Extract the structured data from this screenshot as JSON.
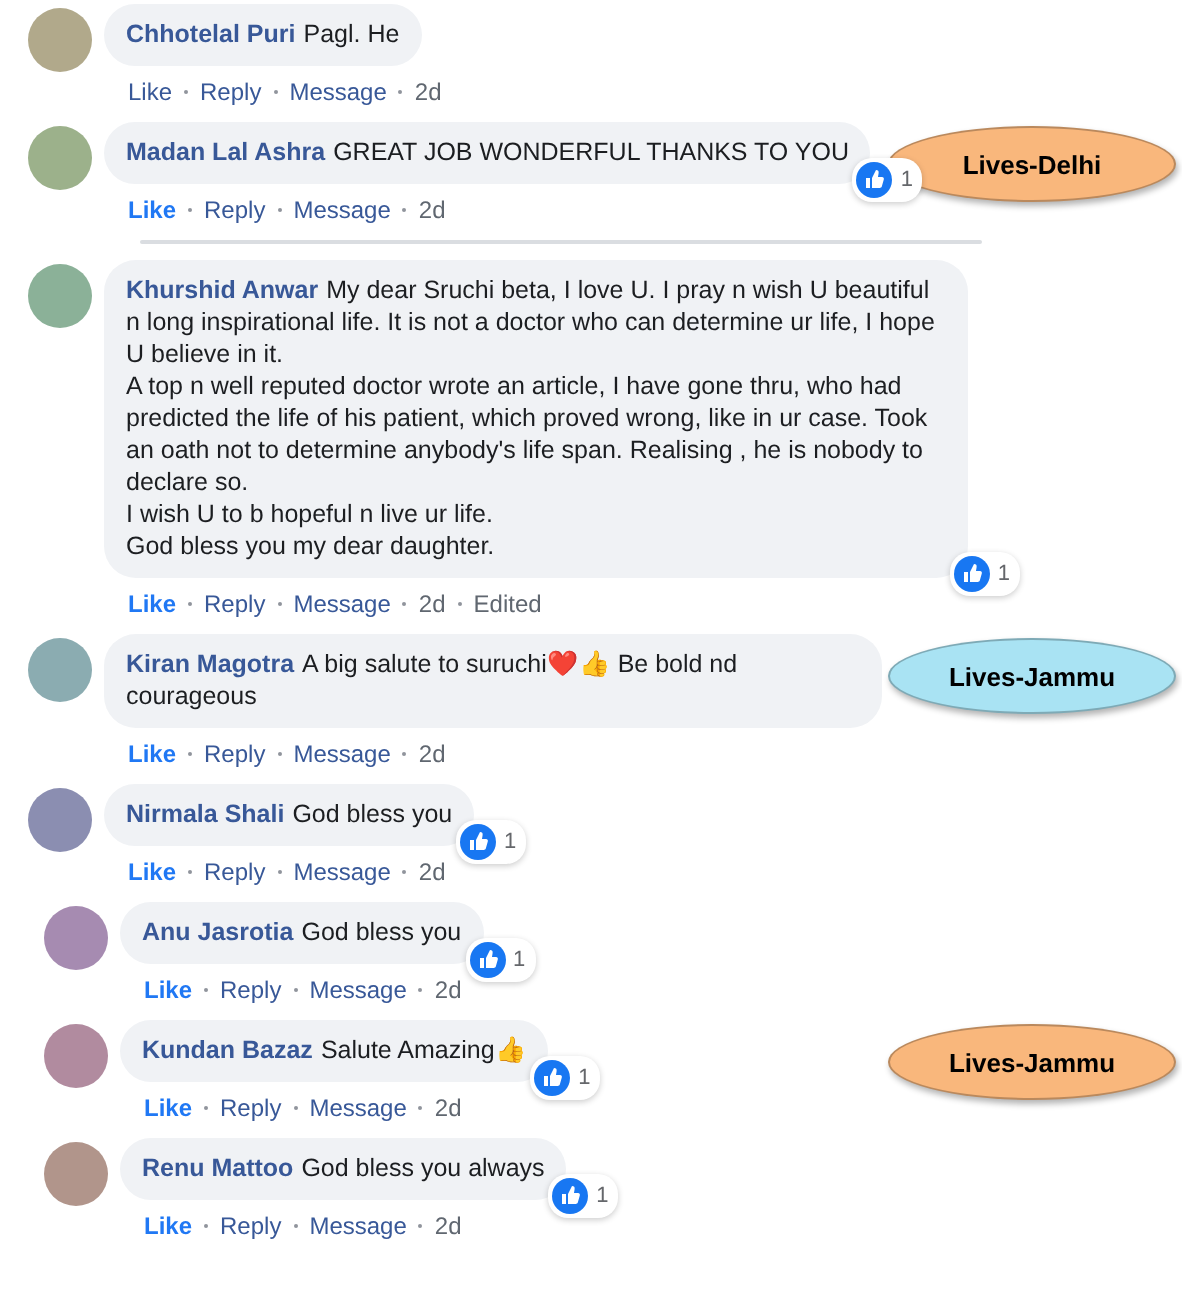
{
  "comments": [
    {
      "name": "Chhotelal Puri",
      "text": "Pagl. He",
      "liked": false,
      "actions": [
        "Like",
        "Reply",
        "Message",
        "2d"
      ]
    },
    {
      "name": "Madan Lal Ashra",
      "text": "GREAT JOB WONDERFUL THANKS TO YOU",
      "liked": true,
      "reactions": "1",
      "actions": [
        "Like",
        "Reply",
        "Message",
        "2d"
      ],
      "callout": {
        "label": "Lives-Delhi",
        "color": "#f9b77c"
      }
    },
    {
      "name": "Khurshid Anwar",
      "text": "My dear Sruchi beta, I love U. I pray n wish U beautiful n long inspirational life. It is not a doctor who can determine ur life, I hope U believe in it.\nA top n well reputed doctor wrote an article, I have gone thru, who had predicted the life of his patient, which proved wrong, like in ur case. Took an oath not to determine anybody's life span. Realising , he is nobody to declare so.\nI wish U to b hopeful n live ur life.\nGod bless you my dear daughter.",
      "liked": true,
      "reactions": "1",
      "actions": [
        "Like",
        "Reply",
        "Message",
        "2d",
        "Edited"
      ]
    },
    {
      "name": "Kiran Magotra",
      "text": "A big salute to suruchi❤️👍 Be bold nd courageous",
      "liked": true,
      "actions": [
        "Like",
        "Reply",
        "Message",
        "2d"
      ],
      "callout": {
        "label": "Lives-Jammu",
        "color": "#a9e3f3"
      }
    },
    {
      "name": "Nirmala Shali",
      "text": "God bless you",
      "liked": true,
      "reactions": "1",
      "actions": [
        "Like",
        "Reply",
        "Message",
        "2d"
      ],
      "replies": [
        {
          "name": "Anu Jasrotia",
          "text": "God bless you",
          "liked": true,
          "reactions": "1",
          "actions": [
            "Like",
            "Reply",
            "Message",
            "2d"
          ]
        },
        {
          "name": "Kundan Bazaz",
          "text": "Salute Amazing👍",
          "liked": true,
          "reactions": "1",
          "actions": [
            "Like",
            "Reply",
            "Message",
            "2d"
          ],
          "callout": {
            "label": "Lives-Jammu",
            "color": "#f9b77c"
          }
        },
        {
          "name": "Renu Mattoo",
          "text": "God bless you always",
          "liked": true,
          "reactions": "1",
          "actions": [
            "Like",
            "Reply",
            "Message",
            "2d"
          ]
        }
      ]
    }
  ]
}
